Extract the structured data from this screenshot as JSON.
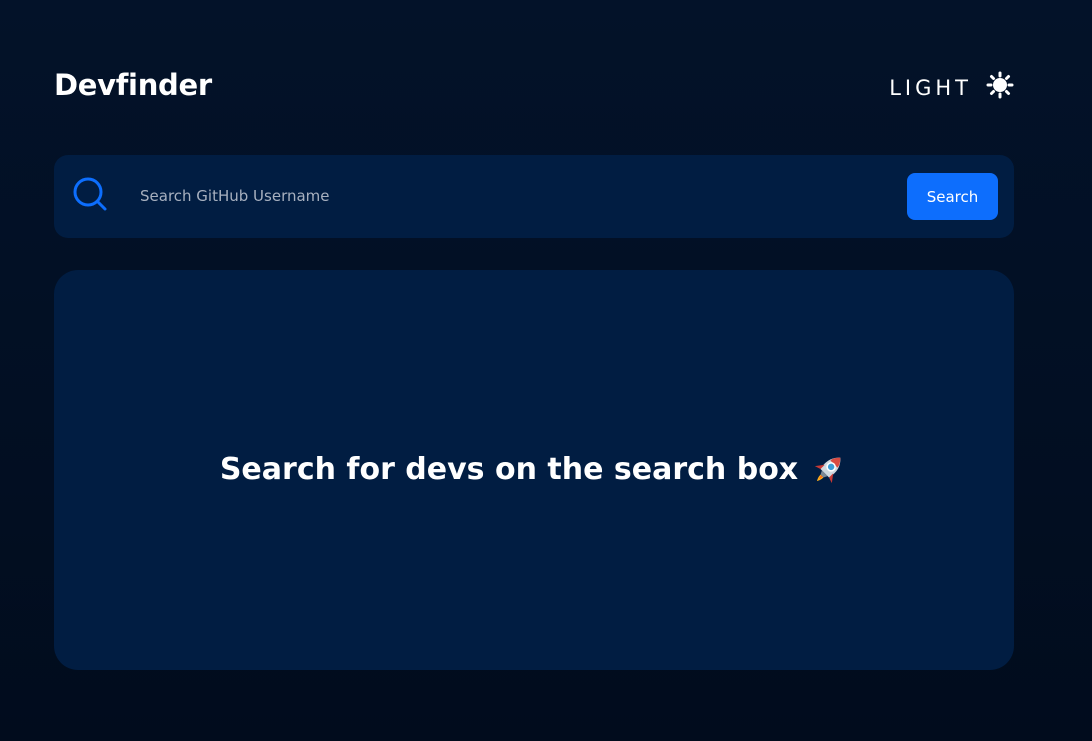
{
  "header": {
    "brand": "Devfinder",
    "theme_toggle": {
      "label": "LIGHT",
      "icon": "sun-icon"
    }
  },
  "search": {
    "icon": "search-icon",
    "value": "",
    "placeholder": "Search GitHub Username",
    "button_label": "Search"
  },
  "result": {
    "empty_message": "Search for devs on the search box",
    "emoji_icon": "rocket-icon"
  },
  "colors": {
    "background": "#020f23",
    "card": "#011d42",
    "accent": "#0d6efd",
    "text": "#ffffff",
    "placeholder": "#a7b0bf"
  }
}
